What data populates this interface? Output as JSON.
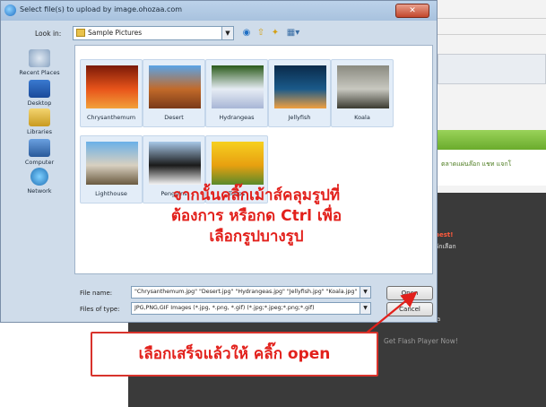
{
  "background": {
    "nav_text": "ตลาดแผ่นล๊อก  แชท  แจกโ",
    "red_text": "hest!",
    "white_text": "ลักเลือก",
    "small_text": "a",
    "flash_text": "Get Flash Player Now!"
  },
  "dialog": {
    "title": "Select file(s) to upload by image.ohozaa.com",
    "close_glyph": "✕",
    "look_in_label": "Look in:",
    "look_in_value": "Sample Pictures",
    "toolbar_icons": [
      "back-icon",
      "up-folder-icon",
      "new-folder-icon",
      "views-menu-icon"
    ],
    "places": [
      {
        "label": "Recent Places",
        "icon": "recent-places-icon"
      },
      {
        "label": "Desktop",
        "icon": "desktop-icon"
      },
      {
        "label": "Libraries",
        "icon": "libraries-icon"
      },
      {
        "label": "Computer",
        "icon": "computer-icon"
      },
      {
        "label": "Network",
        "icon": "network-icon"
      }
    ],
    "files": [
      {
        "name": "Chrysanthemum",
        "colors": [
          "#7a1a08",
          "#e8541a",
          "#f2a13a"
        ]
      },
      {
        "name": "Desert",
        "colors": [
          "#5aa3e6",
          "#c26a2a",
          "#7a3a18"
        ]
      },
      {
        "name": "Hydrangeas",
        "colors": [
          "#2a5a1a",
          "#e6ecf4",
          "#a8b6d6"
        ]
      },
      {
        "name": "Jellyfish",
        "colors": [
          "#0a2a4a",
          "#1a5a8a",
          "#f0a040"
        ]
      },
      {
        "name": "Koala",
        "colors": [
          "#8a8a80",
          "#c8c8c0",
          "#3a3a30"
        ]
      },
      {
        "name": "Lighthouse",
        "colors": [
          "#6ab0e8",
          "#d8d0c0",
          "#6a5a40"
        ]
      },
      {
        "name": "Penguins",
        "colors": [
          "#a8c8e8",
          "#1a1a1a",
          "#f4f4f4"
        ]
      },
      {
        "name": "Tulips",
        "colors": [
          "#f6d020",
          "#e8a010",
          "#5a8a2a"
        ]
      }
    ],
    "annotation_lines": [
      "จากนั้นคลิ๊กเม้าส์คลุมรูปที่",
      "ต้องการ หรือกด Ctrl เพื่อ",
      "เลือกรูปบางรูป"
    ],
    "file_name_label": "File name:",
    "file_name_value": "\"Chrysanthemum.jpg\" \"Desert.jpg\" \"Hydrangeas.jpg\" \"Jellyfish.jpg\" \"Koala.jpg\"",
    "files_of_type_label": "Files of type:",
    "files_of_type_value": "JPG,PNG,GIF Images (*.jpg, *.png, *.gif) (*.jpg;*.jpeg;*.png;*.gif)",
    "open_button": "Open",
    "cancel_button": "Cancel"
  },
  "callout": {
    "text": "เลือกเสร็จแล้วให้ คลิ๊ก open",
    "color": "#e2201b"
  }
}
